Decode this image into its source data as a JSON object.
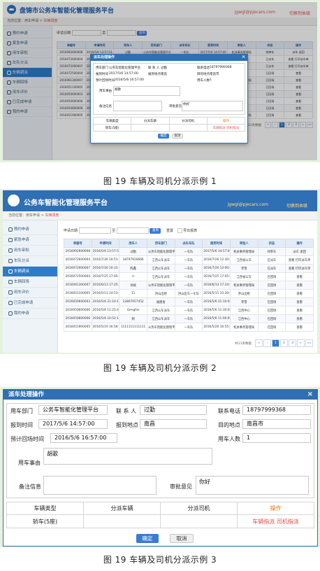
{
  "app": {
    "title": "公务车智能化管理服务平台",
    "title_prefixed": "盘锦市公务车智能化管理服务平台",
    "user_email": "jgwgl@pjecars.com",
    "switch_label": "切换到本级"
  },
  "breadcrumb": {
    "home": "当前位置：",
    "level1": "用车申请",
    "level2": "车辆调度"
  },
  "sidebar": {
    "items": [
      {
        "label": "预约申请"
      },
      {
        "label": "紧急申请"
      },
      {
        "label": "用车审批"
      },
      {
        "label": "车队分派"
      },
      {
        "label": "车辆调派"
      },
      {
        "label": "车辆回场"
      },
      {
        "label": "用车评价"
      },
      {
        "label": "已完成申请"
      },
      {
        "label": "我的申请"
      }
    ]
  },
  "search": {
    "label": "申请日期",
    "to": "至",
    "button": "查询",
    "reset": "重置",
    "export": "导出报表"
  },
  "table": {
    "headers": [
      "单据号",
      "申请时间",
      "用车人",
      "用车部门",
      "派车车队",
      "报到时间",
      "审批人",
      "状态",
      "操作"
    ],
    "rows": [
      [
        "2016092600008",
        "2016/5/6 13:57:51",
        "过勤",
        "公务车智能化管理平台",
        "一车队",
        "2017/5/6 14:57:00",
        "机关事务管理局",
        "待审车",
        "派车 退回"
      ],
      [
        "2016072600004",
        "2016/7/26 10:51:40",
        "18797916666",
        "江西公车派车",
        "一车队",
        "2016/7/26 12:30:00",
        "江西省公车",
        "已派车",
        "查看 打印派车单"
      ],
      [
        "2016072000007",
        "2016/7/20 10:31:13",
        "陈鑫",
        "江西公车派车",
        "一车队",
        "2016/7/20 12:00:00",
        "李雪",
        "已派车",
        "查看 打印派车单"
      ],
      [
        "2016072500004",
        "2016/7/25 17:05:42",
        "rr",
        "江西公车派车",
        "一车队",
        "2016/7/25 17:05:00",
        "江西省公车",
        "已回场",
        "查看"
      ],
      [
        "2016061300007",
        "2016/6/13 17:25:53",
        "徐斌",
        "公务车智能化管理平台",
        "一车队",
        "2016/6/13 17:24:00",
        "机关事务管理局",
        "已回场",
        "查看"
      ],
      [
        "2016051100005",
        "2016/5/11 14:53:42",
        "11",
        "洪山出租",
        "洪山区车一车队",
        "2016/5/11 15:30:00",
        "洪山出租",
        "已回场",
        "查看"
      ],
      [
        "2016050600003",
        "2016/5/6 21:10:19",
        "12807657452",
        "福建省",
        "一车队",
        "2016/5/6 21:10:00",
        "李雪",
        "已回场",
        "查看"
      ],
      [
        "2016050600006",
        "2016/5/6 11:25:40",
        "Genghis",
        "江西公车派车",
        "一车队",
        "2016/5/6 11:30:00",
        "江西中心",
        "已回场",
        "查看"
      ],
      [
        "2016050600006",
        "2016/5/6 10:52:18",
        "刚",
        "江西公车派车",
        "一车队",
        "2016/5/6 11:00:00",
        "江西中心",
        "已回场",
        "查看"
      ],
      [
        "2016051900005",
        "2016/5/19 16:56:06",
        "1111111111111",
        "公务车智能化管理平台",
        "一车队",
        "2016/5/20 16:55:00",
        "机关事务管理局",
        "已回场",
        "查看"
      ]
    ]
  },
  "pager": {
    "total": "共11条数据",
    "pages": [
      "1",
      "2",
      "3"
    ],
    "next": "»",
    "last": "»»",
    "first": "«",
    "prev": "‹"
  },
  "dialog": {
    "title": "派车处理操作",
    "close": "×",
    "fields": {
      "dept_label": "用车部门",
      "dept_value": "公务车智能化管理平台",
      "contact_label": "联 系 人",
      "contact_value": "过勤",
      "phone_label": "联系电话",
      "phone_value": "18797999368",
      "report_time_label": "报到时间",
      "report_time_value": "2017/5/6 14:57:00",
      "report_place_label": "报到地点",
      "report_place_value": "南昌",
      "dest_label": "目的地点",
      "dest_value": "南昌市",
      "return_label": "预计回场时间",
      "return_value": "2016/5/6 16:57:00",
      "people_label": "用车人数",
      "people_value": "1",
      "reason_label": "用车事由",
      "reason_value": "胡歌",
      "remark_label": "备注信息",
      "remark_value": "",
      "opinion_label": "审批意见",
      "opinion_value": "你好"
    },
    "vehicle_table": {
      "headers": [
        "车辆类型",
        "分派车辆",
        "分派司机",
        "操作"
      ],
      "row": {
        "type": "轿车(5座)",
        "vehicle": "",
        "driver": "",
        "op_vehicle": "车辆指派",
        "op_driver": "司机指派"
      }
    },
    "ok": "确定",
    "cancel": "取消"
  },
  "captions": {
    "c1": "图 19    车辆及司机分派示例 1",
    "c2": "图 19    车辆及司机分派示例 2",
    "c3": "图 19    车辆及司机分派示例 3"
  },
  "colors": {
    "brand": "#2f6fb3",
    "panel_bg": "#e6f2df",
    "orange": "#e8730c",
    "red": "#d9534f"
  }
}
